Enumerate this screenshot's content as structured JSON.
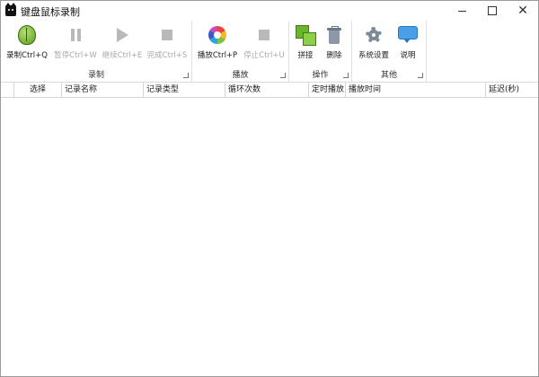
{
  "window": {
    "title": "键盘鼠标录制"
  },
  "ribbon": {
    "groups": [
      {
        "label": "录制",
        "buttons": [
          {
            "label": "录制Ctrl+Q",
            "icon": "bug-icon"
          },
          {
            "label": "暂停Ctrl+W",
            "icon": "pause-icon"
          },
          {
            "label": "继续Ctrl+E",
            "icon": "play-icon"
          },
          {
            "label": "完成Ctrl+S",
            "icon": "stop-icon"
          }
        ]
      },
      {
        "label": "播放",
        "buttons": [
          {
            "label": "播放Ctrl+P",
            "icon": "color-wheel-icon"
          },
          {
            "label": "停止Ctrl+U",
            "icon": "stop-icon"
          }
        ]
      },
      {
        "label": "操作",
        "buttons": [
          {
            "label": "拼接",
            "icon": "join-icon"
          },
          {
            "label": "删除",
            "icon": "trash-icon"
          }
        ]
      },
      {
        "label": "其他",
        "buttons": [
          {
            "label": "系统设置",
            "icon": "gear-icon"
          },
          {
            "label": "说明",
            "icon": "speech-bubble-icon"
          }
        ]
      }
    ]
  },
  "table": {
    "columns": [
      "选择",
      "记录名称",
      "记录类型",
      "循环次数",
      "定时播放",
      "播放时间",
      "延迟(秒)"
    ],
    "rows": []
  },
  "colors": {
    "disabled_text": "#a8a8a8",
    "border": "#d5d5d5"
  }
}
